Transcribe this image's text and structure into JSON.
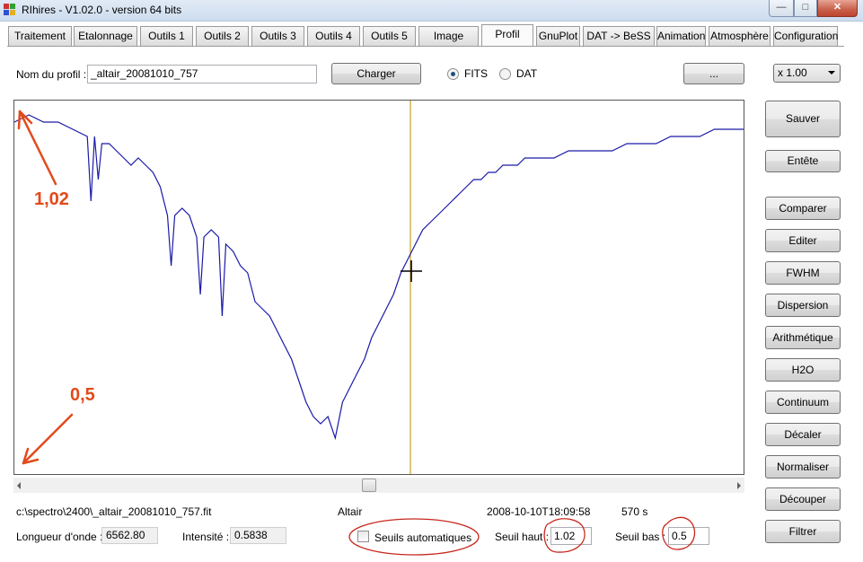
{
  "window": {
    "title": "RIhires - V1.02.0 - version 64 bits"
  },
  "tabs": [
    {
      "label": "Traitement"
    },
    {
      "label": "Etalonnage"
    },
    {
      "label": "Outils 1"
    },
    {
      "label": "Outils 2"
    },
    {
      "label": "Outils 3"
    },
    {
      "label": "Outils 4"
    },
    {
      "label": "Outils 5"
    },
    {
      "label": "Image"
    },
    {
      "label": "Profil"
    },
    {
      "label": "GnuPlot"
    },
    {
      "label": "DAT -> BeSS"
    },
    {
      "label": "Animation"
    },
    {
      "label": "Atmosphère"
    },
    {
      "label": "Configuration"
    }
  ],
  "active_tab": "Profil",
  "toolbar": {
    "profile_name_label": "Nom du profil :",
    "profile_name_value": "_altair_20081010_757",
    "load_button": "Charger",
    "radio_fits": "FITS",
    "radio_dat": "DAT",
    "selected_format": "FITS",
    "browse_button": "...",
    "zoom_value": "x 1.00"
  },
  "side_buttons": {
    "save": "Sauver",
    "header": "Entête",
    "compare": "Comparer",
    "edit": "Editer",
    "fwhm": "FWHM",
    "dispersion": "Dispersion",
    "arithmetic": "Arithmétique",
    "h2o": "H2O",
    "continuum": "Continuum",
    "shift": "Décaler",
    "normalize": "Normaliser",
    "cut": "Découper",
    "filter": "Filtrer"
  },
  "status": {
    "file_path": "c:\\spectro\\2400\\_altair_20081010_757.fit",
    "object": "Altair",
    "date": "2008-10-10T18:09:58",
    "exposure": "570 s",
    "wavelength_label": "Longueur d'onde :",
    "wavelength_value": "6562.80",
    "intensity_label": "Intensité :",
    "intensity_value": "0.5838",
    "auto_thresholds_label": "Seuils automatiques",
    "auto_thresholds_checked": false,
    "high_threshold_label": "Seuil haut :",
    "high_threshold_value": "1.02",
    "low_threshold_label": "Seuil bas :",
    "low_threshold_value": "0.5"
  },
  "annotations": {
    "top_value": "1,02",
    "bottom_value": "0,5"
  },
  "colors": {
    "spectrum": "#1a1aa8",
    "cursor_line": "#c8a020",
    "annotation": "#e24a1b"
  },
  "chart_data": {
    "type": "line",
    "title": "",
    "xlabel": "",
    "ylabel": "",
    "ylim": [
      0.5,
      1.02
    ],
    "cursor": {
      "wavelength": 6562.8,
      "intensity": 0.5838
    },
    "series": [
      {
        "x": [
          0,
          0.02,
          0.04,
          0.06,
          0.08,
          0.1,
          0.105,
          0.11,
          0.115,
          0.12,
          0.13,
          0.14,
          0.15,
          0.16,
          0.17,
          0.18,
          0.19,
          0.2,
          0.21,
          0.215,
          0.22,
          0.23,
          0.24,
          0.25,
          0.255,
          0.26,
          0.27,
          0.28,
          0.285,
          0.29,
          0.3,
          0.31,
          0.32,
          0.33,
          0.34,
          0.35,
          0.36,
          0.37,
          0.38,
          0.39,
          0.4,
          0.41,
          0.42,
          0.43,
          0.44,
          0.45,
          0.46,
          0.47,
          0.48,
          0.49,
          0.5,
          0.51,
          0.52,
          0.53,
          0.54,
          0.55,
          0.56,
          0.57,
          0.58,
          0.59,
          0.6,
          0.61,
          0.62,
          0.63,
          0.64,
          0.65,
          0.66,
          0.67,
          0.68,
          0.69,
          0.7,
          0.72,
          0.74,
          0.76,
          0.78,
          0.8,
          0.82,
          0.84,
          0.86,
          0.88,
          0.9,
          0.92,
          0.94,
          0.96,
          0.98,
          1.0
        ],
        "y": [
          0.99,
          1.0,
          0.99,
          0.99,
          0.98,
          0.97,
          0.88,
          0.97,
          0.91,
          0.96,
          0.96,
          0.95,
          0.94,
          0.93,
          0.94,
          0.93,
          0.92,
          0.9,
          0.86,
          0.79,
          0.86,
          0.87,
          0.86,
          0.83,
          0.75,
          0.83,
          0.84,
          0.83,
          0.72,
          0.82,
          0.81,
          0.79,
          0.78,
          0.74,
          0.73,
          0.72,
          0.7,
          0.68,
          0.66,
          0.63,
          0.6,
          0.58,
          0.57,
          0.58,
          0.55,
          0.6,
          0.62,
          0.64,
          0.66,
          0.69,
          0.71,
          0.73,
          0.75,
          0.78,
          0.8,
          0.82,
          0.84,
          0.85,
          0.86,
          0.87,
          0.88,
          0.89,
          0.9,
          0.91,
          0.91,
          0.92,
          0.92,
          0.93,
          0.93,
          0.93,
          0.94,
          0.94,
          0.94,
          0.95,
          0.95,
          0.95,
          0.95,
          0.96,
          0.96,
          0.96,
          0.97,
          0.97,
          0.97,
          0.98,
          0.98,
          0.98
        ]
      }
    ]
  }
}
